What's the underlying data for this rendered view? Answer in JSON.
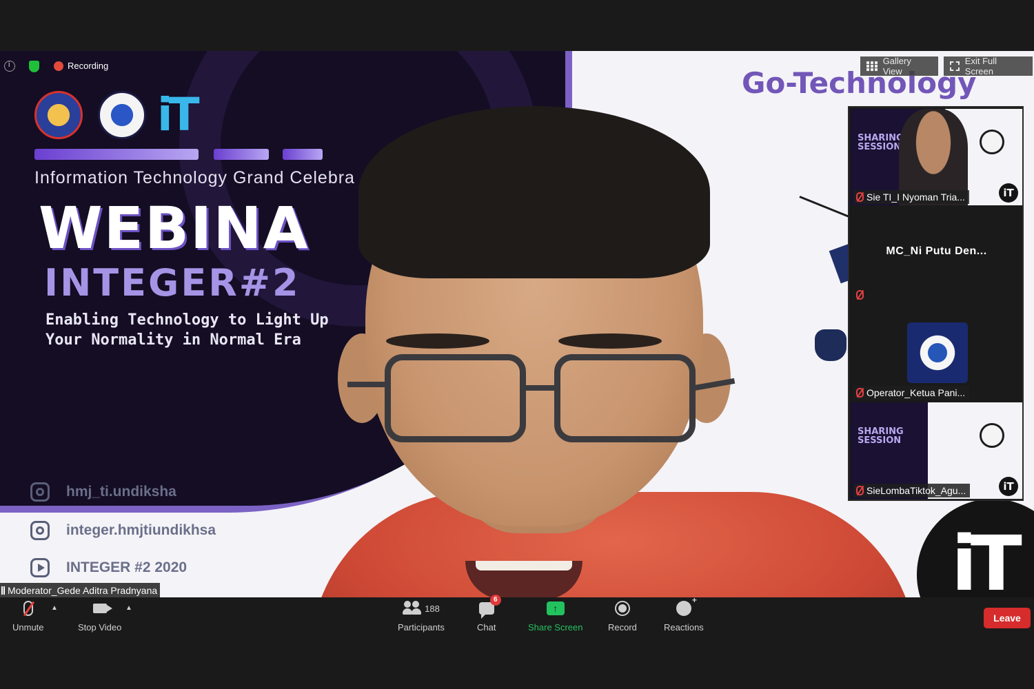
{
  "meeting": {
    "recording_label": "Recording",
    "view_button": "Gallery View",
    "fullscreen_button": "Exit Full Screen"
  },
  "slide": {
    "event_line": "Information Technology Grand Celebra",
    "headline": "WEBINA",
    "subtitle": "INTEGER#2",
    "tagline_line1": "Enabling Technology to Light Up",
    "tagline_line2": "Your Normality in Normal Era",
    "brand": "Go-Technology",
    "logo_text": "iT",
    "socials": [
      {
        "icon": "instagram-icon",
        "text": "hmj_ti.undiksha"
      },
      {
        "icon": "instagram-icon",
        "text": "integer.hmjtiundikhsa"
      },
      {
        "icon": "youtube-icon",
        "text": "INTEGER #2 2020"
      }
    ]
  },
  "active_speaker": {
    "name": "Moderator_Gede Aditra Pradnyana"
  },
  "participants_panel": [
    {
      "name": "Sie TI_I Nyoman Tria...",
      "muted": true,
      "video": "slide"
    },
    {
      "name": "MC_Ni Putu Den...",
      "muted": true,
      "video": "off"
    },
    {
      "name": "Operator_Ketua Pani...",
      "muted": true,
      "video": "logo"
    },
    {
      "name": "SieLombaTiktok_Agu...",
      "muted": true,
      "video": "slide"
    }
  ],
  "thumb_slide": {
    "title_line1": "SHARING",
    "title_line2": "SESSION",
    "brand": "Go-Technology",
    "logo_text": "iT"
  },
  "toolbar": {
    "unmute": "Unmute",
    "stop_video": "Stop Video",
    "participants": "Participants",
    "participants_count": "188",
    "chat": "Chat",
    "chat_badge": "6",
    "share_screen": "Share Screen",
    "record": "Record",
    "reactions": "Reactions",
    "leave": "Leave"
  },
  "colors": {
    "share_green": "#22c35e",
    "leave_red": "#d62c2c",
    "mute_red": "#e64141",
    "slide_purple": "#7256b8"
  }
}
